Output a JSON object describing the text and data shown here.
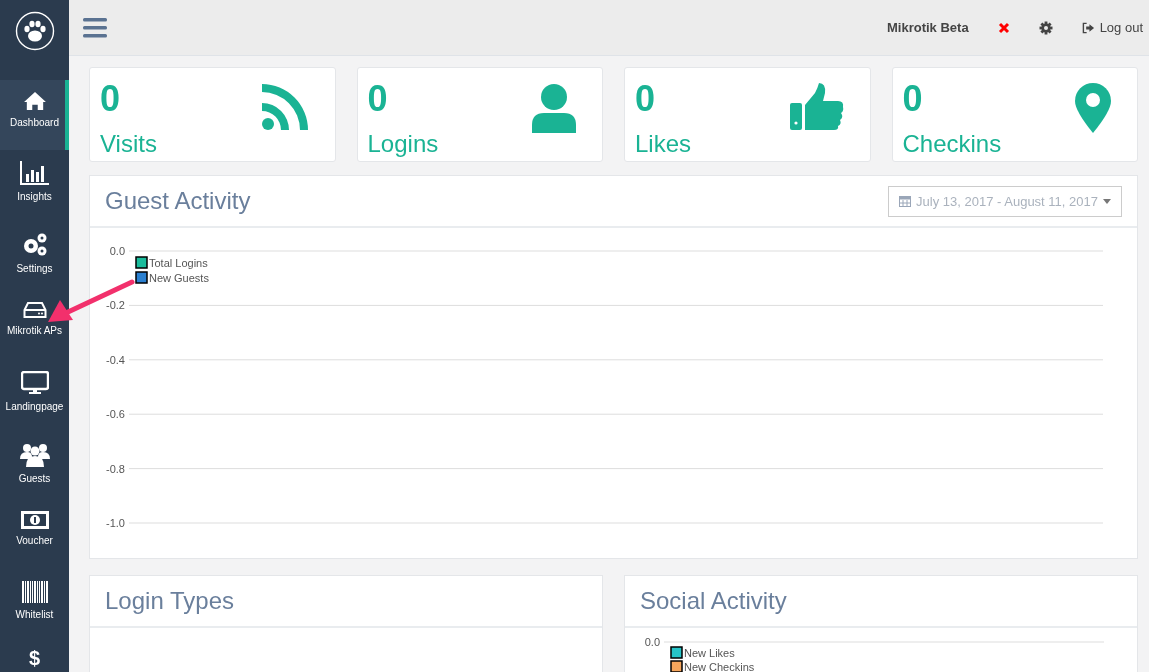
{
  "sidebar": {
    "items": [
      {
        "label": "Dashboard",
        "selected": true
      },
      {
        "label": "Insights",
        "selected": false
      },
      {
        "label": "Settings",
        "selected": false
      },
      {
        "label": "Mikrotik APs",
        "selected": false
      },
      {
        "label": "Landingpage",
        "selected": false
      },
      {
        "label": "Guests",
        "selected": false
      },
      {
        "label": "Voucher",
        "selected": false
      },
      {
        "label": "Whitelist",
        "selected": false
      },
      {
        "glyph": "$",
        "selected": false
      }
    ]
  },
  "topbar": {
    "account": "Mikrotik Beta",
    "logout": "Log out"
  },
  "stats": [
    {
      "value": "0",
      "label": "Visits"
    },
    {
      "value": "0",
      "label": "Logins"
    },
    {
      "value": "0",
      "label": "Likes"
    },
    {
      "value": "0",
      "label": "Checkins"
    }
  ],
  "guest_activity": {
    "title": "Guest Activity",
    "date_range": "July 13, 2017 - August 11, 2017",
    "chart_data": {
      "type": "line",
      "grid": true,
      "ylim": [
        -1,
        0
      ],
      "yticks": [
        {
          "value": 0,
          "label": "0.0"
        },
        {
          "value": -0.2,
          "label": "-0.2"
        },
        {
          "value": -0.4,
          "label": "-0.4"
        },
        {
          "value": -0.6,
          "label": "-0.6"
        },
        {
          "value": -0.8,
          "label": "-0.8"
        },
        {
          "value": -1,
          "label": "-1.0"
        }
      ],
      "series": [
        {
          "name": "Total Logins",
          "color": "#1abc9c"
        },
        {
          "name": "New Guests",
          "color": "#2a7fd0"
        }
      ]
    }
  },
  "login_types": {
    "title": "Login Types"
  },
  "social_activity": {
    "title": "Social Activity",
    "axis_label": "0.0",
    "legend": [
      {
        "name": "New Likes",
        "color": "#26c4c8"
      },
      {
        "name": "New Checkins",
        "color": "#f5a55c"
      }
    ]
  },
  "annotation": {
    "kind": "arrow"
  }
}
